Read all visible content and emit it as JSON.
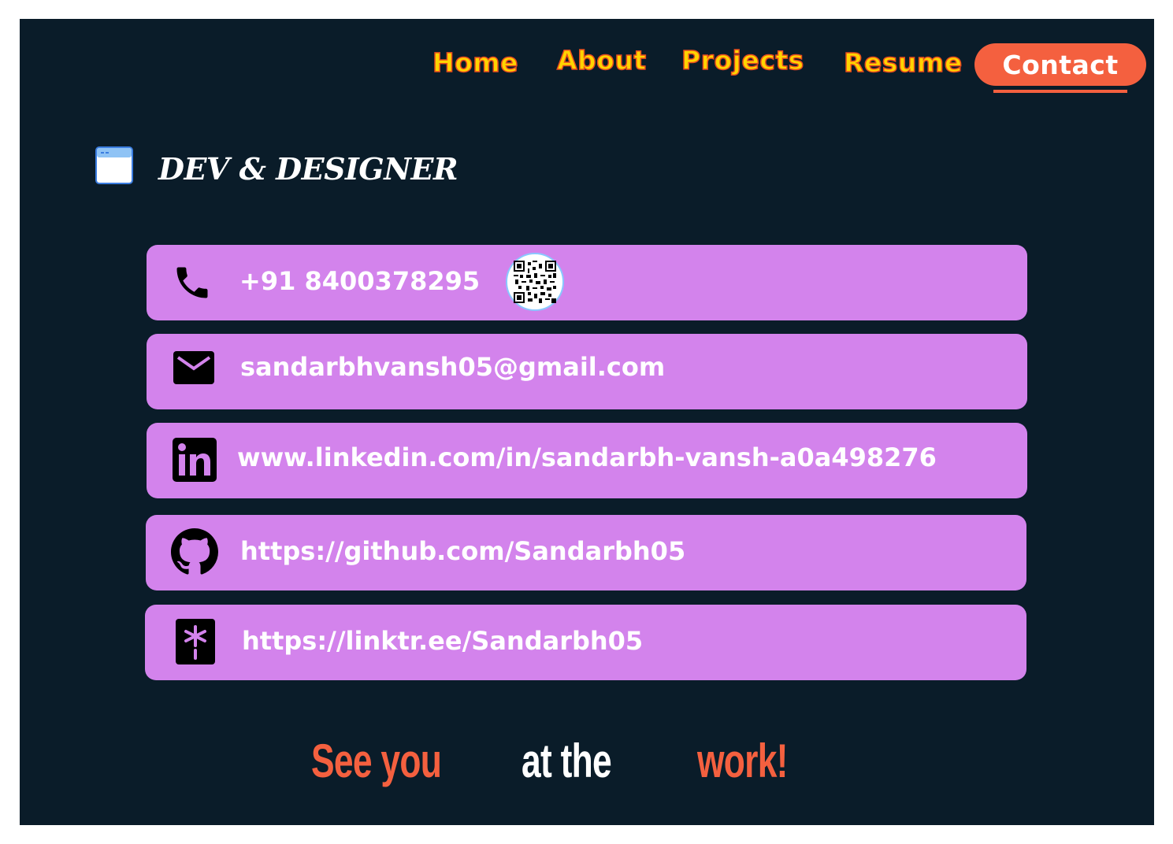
{
  "nav": {
    "links": [
      "Home",
      "About",
      "Projects",
      "Resume"
    ],
    "contact_label": "Contact",
    "colors": {
      "link": "#ffd400",
      "link_outline": "#e84c1e",
      "contact_bg": "#f4603f"
    }
  },
  "brand": {
    "icon": "browser-window-icon",
    "title": "DEV & DESIGNER"
  },
  "contacts": [
    {
      "icon": "phone-icon",
      "text": "+91 8400378295",
      "extra_icon": "qr-code-icon"
    },
    {
      "icon": "mail-icon",
      "text": "sandarbhvansh05@gmail.com"
    },
    {
      "icon": "linkedin-icon",
      "text": "www.linkedin.com/in/sandarbh-vansh-a0a498276"
    },
    {
      "icon": "github-icon",
      "text": "https://github.com/Sandarbh05"
    },
    {
      "icon": "linktree-icon",
      "text": "https://linktr.ee/Sandarbh05"
    }
  ],
  "footer": {
    "part1": "See you",
    "part2": "at the",
    "part3": "work!",
    "colors": {
      "accent": "#f4603f",
      "plain": "#ffffff"
    }
  },
  "theme": {
    "page_bg": "#0a1c29",
    "card_bg": "#d383ec"
  }
}
